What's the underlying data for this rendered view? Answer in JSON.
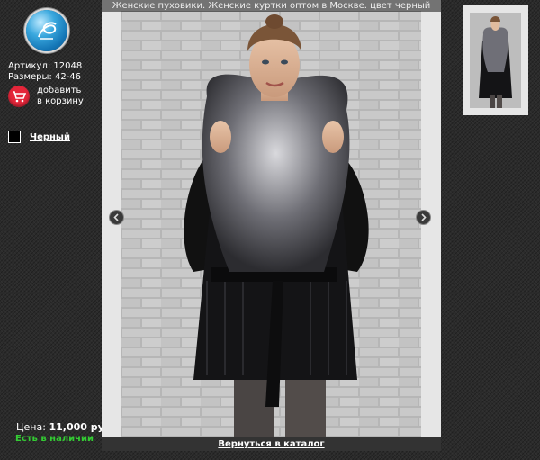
{
  "product": {
    "title": "Женские пуховики. Женские куртки оптом в Москве. цвет черный",
    "sku": "Артикул: 12048",
    "sizes": "Размеры: 42-46",
    "cart_line1": "добавить",
    "cart_line2": "в корзину",
    "color": "Черный",
    "price_label": "Цена:",
    "price_value": "11,000 руб.",
    "availability": "Есть в наличии",
    "back_link": "Вернуться в каталог"
  },
  "colors": {
    "availability": "#33cc33",
    "cart": "#e4263a",
    "logo": "#1e8ccf",
    "swatch": "#000000"
  },
  "icons": {
    "logo": "circular-swirl-logo",
    "cart": "shopping-cart-icon",
    "prev": "chevron-left-icon",
    "next": "chevron-right-icon"
  }
}
